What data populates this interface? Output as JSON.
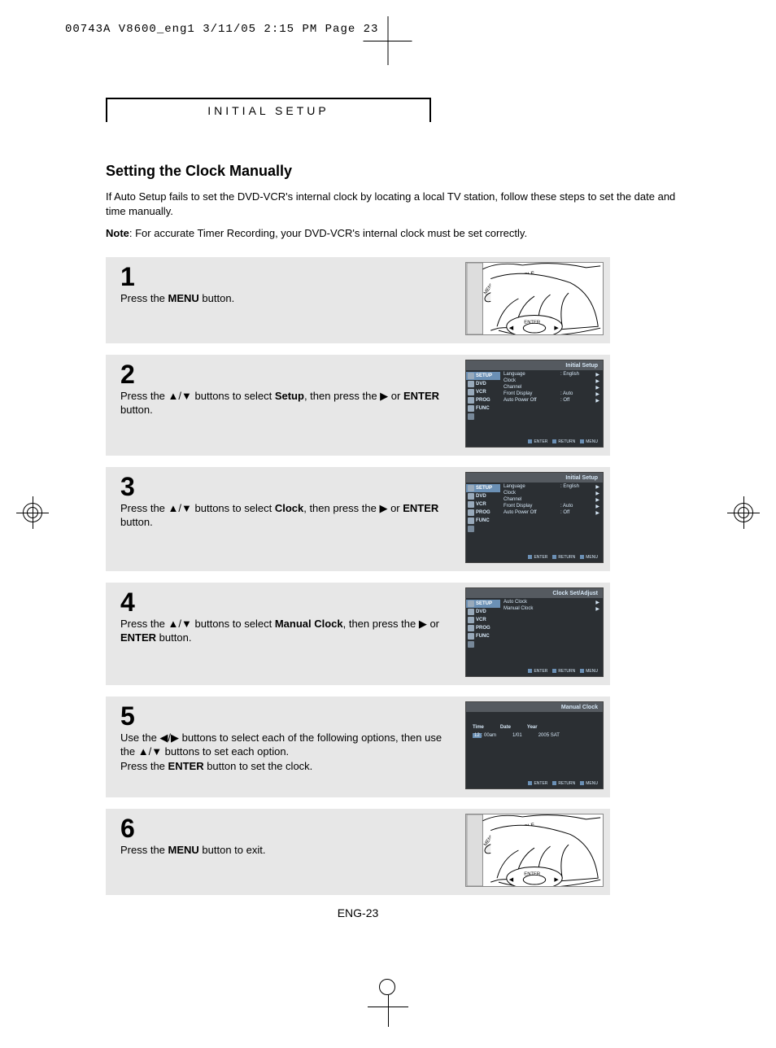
{
  "print_header": "00743A V8600_eng1  3/11/05  2:15 PM  Page 23",
  "section_header": "INITIAL SETUP",
  "heading": "Setting the Clock Manually",
  "intro": "If Auto Setup fails to set the DVD-VCR's internal clock by locating a local TV station, follow these steps to set the date and time manually.",
  "note_label": "Note",
  "note_body": ": For accurate Timer Recording, your DVD-VCR's internal clock must be set correctly.",
  "page_number": "ENG-23",
  "glyph": {
    "up": "▲",
    "down": "▼",
    "left": "◀",
    "right": "▶",
    "play": "▶"
  },
  "steps": {
    "s1": {
      "num": "1",
      "pre": "Press the ",
      "b1": "MENU",
      "post": " button."
    },
    "s2": {
      "num": "2",
      "t1": "Press the ",
      "t2": " buttons to select ",
      "b1": "Setup",
      "t3": ", then press the ",
      "t4": " or ",
      "b2": "ENTER",
      "t5": " button."
    },
    "s3": {
      "num": "3",
      "t1": "Press the ",
      "t2": " buttons to select ",
      "b1": "Clock",
      "t3": ", then press the ",
      "t4": " or ",
      "b2": "ENTER",
      "t5": " button."
    },
    "s4": {
      "num": "4",
      "t1": "Press the ",
      "t2": " buttons to select ",
      "b1": "Manual Clock",
      "t3": ", then press the ",
      "t4": " or ",
      "b2": "ENTER",
      "t5": " button."
    },
    "s5": {
      "num": "5",
      "t1": "Use the ",
      "t2": " buttons to select each of the following options, then use the ",
      "t3": " buttons to set each option.",
      "t4": "Press the ",
      "b1": "ENTER",
      "t5": " button to set the clock."
    },
    "s6": {
      "num": "6",
      "pre": "Press the ",
      "b1": "MENU",
      "post": " button to exit."
    }
  },
  "remote_labels": {
    "subtitle": "SUBTITLE",
    "menu": "MENU",
    "enter": "ENTER"
  },
  "osd": {
    "initial_title": "Initial Setup",
    "clock_title": "Clock Set/Adjust",
    "manual_title": "Manual Clock",
    "side": [
      "SETUP",
      "DVD",
      "VCR",
      "PROG",
      "FUNC"
    ],
    "footer": [
      "ENTER",
      "RETURN",
      "MENU"
    ],
    "setup_menu": [
      {
        "k": "Language",
        "v": ": English"
      },
      {
        "k": "Clock",
        "v": ""
      },
      {
        "k": "Channel",
        "v": ""
      },
      {
        "k": "Front Display",
        "v": ": Auto"
      },
      {
        "k": "Auto Power Off",
        "v": ": Off"
      }
    ],
    "clock_menu": [
      {
        "k": "Auto Clock",
        "v": ""
      },
      {
        "k": "Manual Clock",
        "v": ""
      }
    ],
    "manual": {
      "cols": [
        "Time",
        "Date",
        "Year"
      ],
      "time_h": "12",
      "time_rest": ": 00am",
      "date": "1/01",
      "year": "2005  SAT"
    }
  }
}
